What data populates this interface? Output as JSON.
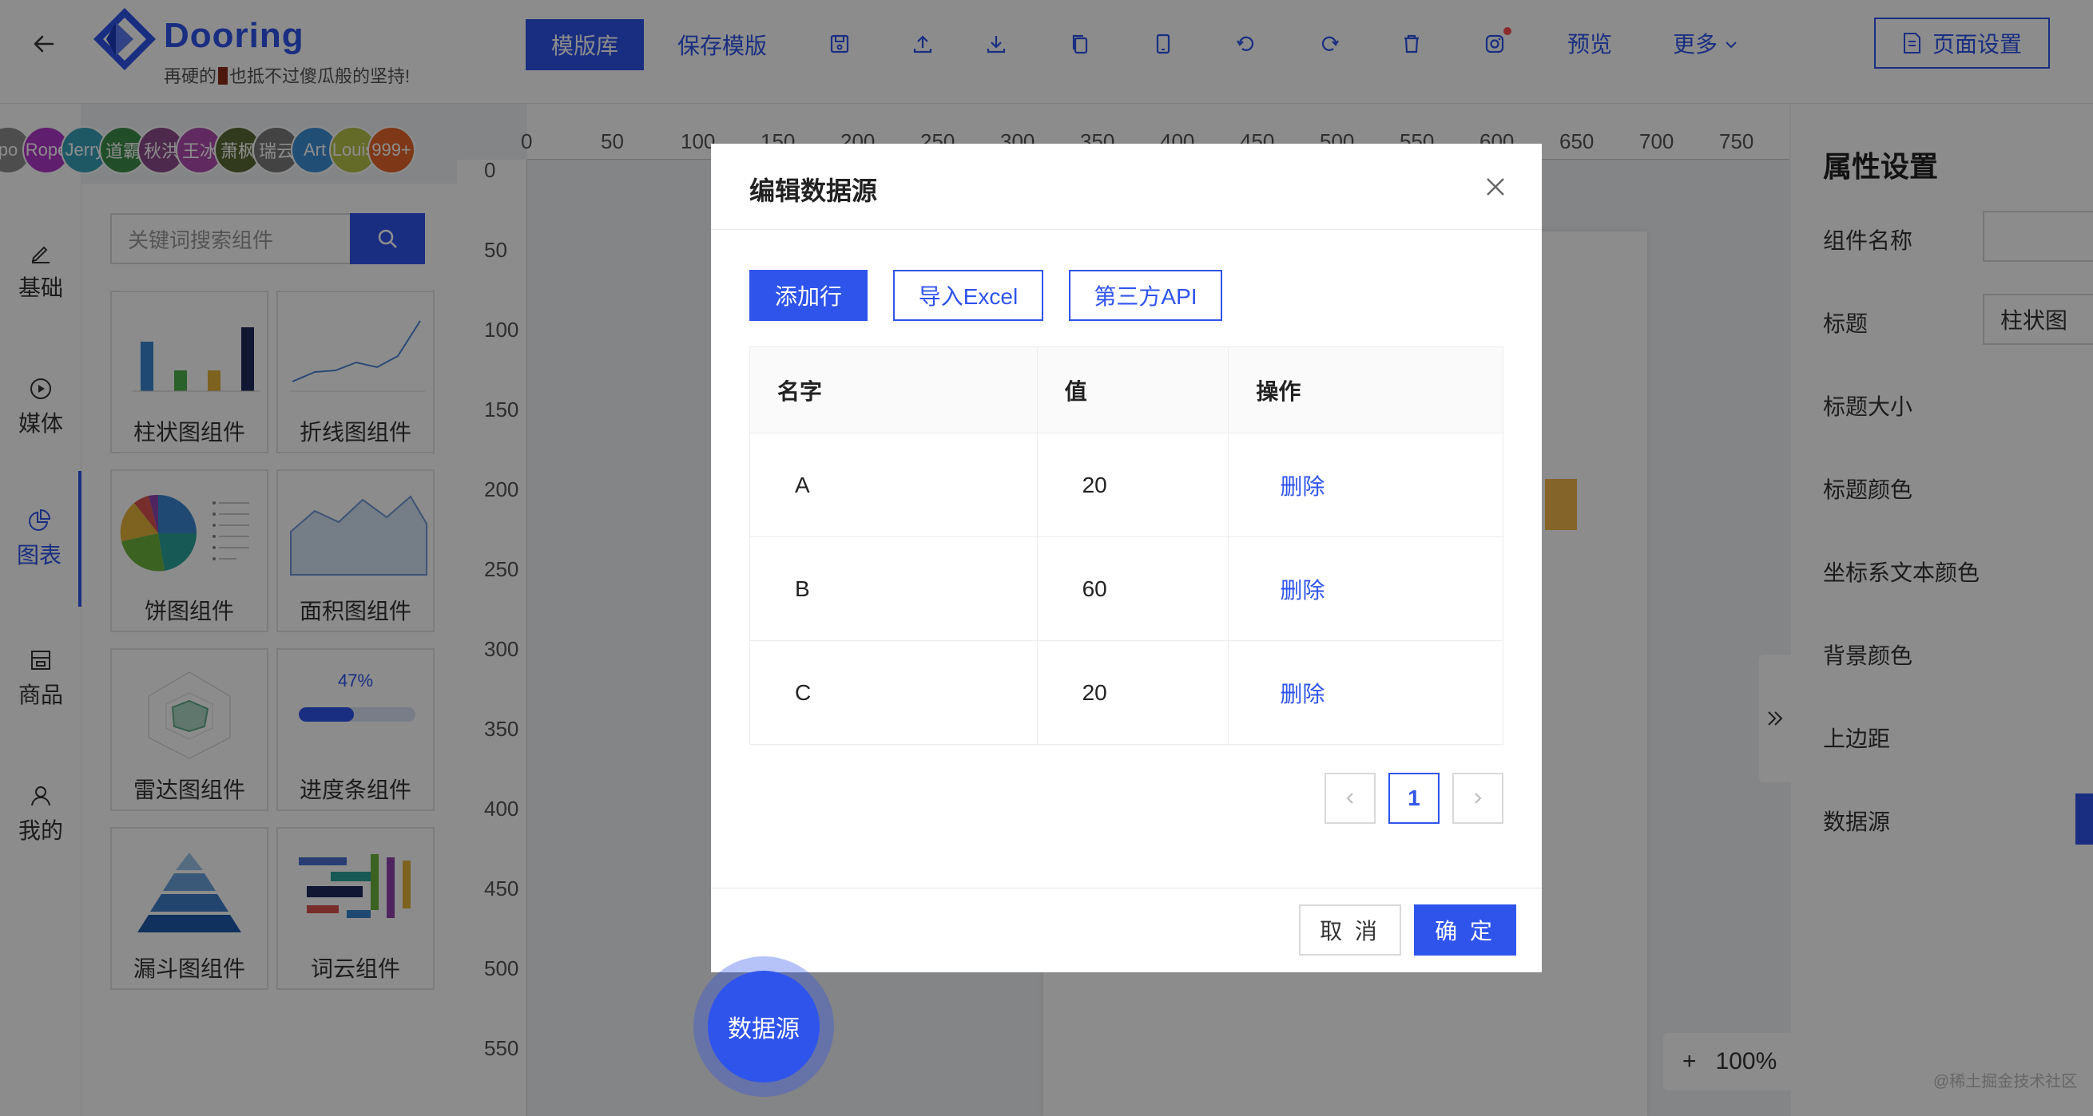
{
  "header": {
    "logo_text": "Dooring",
    "slogan_before": "再硬的",
    "slogan_after": "也抵不过傻瓜般的坚持!",
    "template_library": "模版库",
    "save_template": "保存模版",
    "preview": "预览",
    "more": "更多",
    "page_settings": "页面设置"
  },
  "avatars": [
    {
      "label": "po",
      "color": "#8c8c8c"
    },
    {
      "label": "Rope",
      "color": "#b037c8"
    },
    {
      "label": "Jerry",
      "color": "#3aa0b8"
    },
    {
      "label": "道霸",
      "color": "#3d8f4a"
    },
    {
      "label": "秋洪",
      "color": "#8d4d8c"
    },
    {
      "label": "王冰",
      "color": "#b04db0"
    },
    {
      "label": "萧枫",
      "color": "#5c6a35"
    },
    {
      "label": "瑞云",
      "color": "#7a7a7a"
    },
    {
      "label": "Art",
      "color": "#3d8fd6"
    },
    {
      "label": "Louis",
      "color": "#b6c24a"
    },
    {
      "label": "999+",
      "color": "#e8662a"
    }
  ],
  "left_nav": [
    {
      "label": "基础",
      "icon": "pen-icon"
    },
    {
      "label": "媒体",
      "icon": "play-circle-icon"
    },
    {
      "label": "图表",
      "icon": "pie-chart-icon"
    },
    {
      "label": "商品",
      "icon": "shop-icon"
    },
    {
      "label": "我的",
      "icon": "user-icon"
    }
  ],
  "search": {
    "placeholder": "关键词搜索组件"
  },
  "components": [
    {
      "name": "柱状图组件"
    },
    {
      "name": "折线图组件"
    },
    {
      "name": "饼图组件"
    },
    {
      "name": "面积图组件"
    },
    {
      "name": "雷达图组件"
    },
    {
      "name": "进度条组件",
      "progress_label": "47%",
      "progress": 0.47
    },
    {
      "name": "漏斗图组件"
    },
    {
      "name": "词云组件"
    }
  ],
  "ruler": {
    "h": [
      "0",
      "50",
      "100",
      "150",
      "200",
      "250",
      "300",
      "350",
      "400",
      "450",
      "500",
      "550",
      "600",
      "650",
      "700",
      "750"
    ],
    "v": [
      "0",
      "50",
      "100",
      "150",
      "200",
      "250",
      "300",
      "350",
      "400",
      "450",
      "500",
      "550"
    ]
  },
  "zoom": {
    "plus": "+",
    "level": "100%",
    "minus": "-"
  },
  "right_panel": {
    "title": "属性设置",
    "labels": [
      "组件名称",
      "标题",
      "标题大小",
      "标题颜色",
      "坐标系文本颜色",
      "背景颜色",
      "上边距",
      "数据源"
    ],
    "title_value": "柱状图"
  },
  "modal": {
    "title": "编辑数据源",
    "add_row": "添加行",
    "import_excel": "导入Excel",
    "third_party_api": "第三方API",
    "columns": [
      "名字",
      "值",
      "操作"
    ],
    "rows": [
      {
        "name": "A",
        "value": "20",
        "op": "删除"
      },
      {
        "name": "B",
        "value": "60",
        "op": "删除"
      },
      {
        "name": "C",
        "value": "20",
        "op": "删除"
      }
    ],
    "current_page": "1",
    "cancel": "取 消",
    "ok": "确 定"
  },
  "floating_button": "数据源",
  "watermark": "@稀土掘金技术社区",
  "colors": {
    "accent": "#2f54eb",
    "danger_dot": "#ff4d4f",
    "bar_peek": "#f3b64c"
  }
}
